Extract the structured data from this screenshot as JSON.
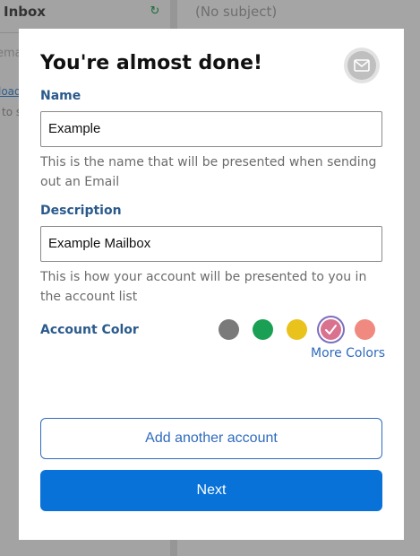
{
  "background": {
    "inbox_title": "Inbox",
    "email_placeholder": "ema",
    "load_link": "load",
    "to_text": "to s",
    "subject": "(No subject)"
  },
  "dialog": {
    "title": "You're almost done!",
    "icon": "envelope-icon",
    "name": {
      "label": "Name",
      "value": "Example",
      "help": "This is the name that will be presented when sending out an Email"
    },
    "description": {
      "label": "Description",
      "value": "Example Mailbox",
      "help": "This is how your account will be presented to you in the account list"
    },
    "account_color": {
      "label": "Account Color",
      "swatches": [
        "#7a7a7a",
        "#1aa055",
        "#e9c21c",
        "#d9728f",
        "#f08a80"
      ],
      "selected_index": 3,
      "more_colors_label": "More Colors"
    },
    "add_another_label": "Add another account",
    "next_label": "Next"
  }
}
